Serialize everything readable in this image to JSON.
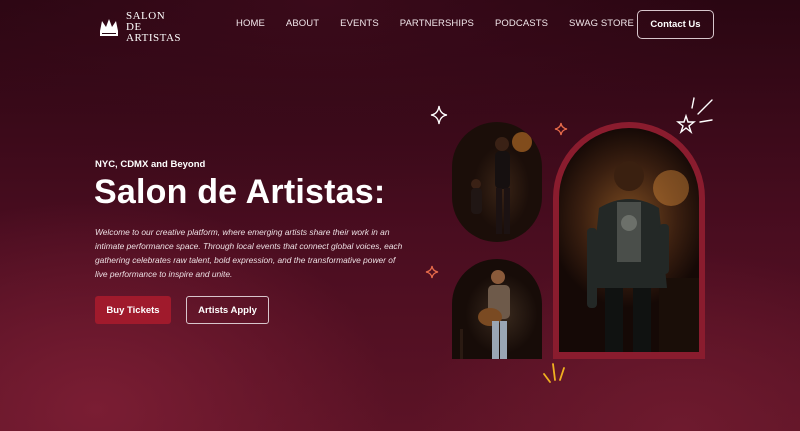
{
  "brand": {
    "name_line1": "SALON",
    "name_line2": "DE",
    "name_line3": "ARTISTAS",
    "logo_icon": "crown-logo-icon"
  },
  "nav": {
    "items": [
      "HOME",
      "ABOUT",
      "EVENTS",
      "PARTNERSHIPS",
      "PODCASTS",
      "SWAG STORE"
    ],
    "contact_label": "Contact Us"
  },
  "hero": {
    "tagline": "NYC, CDMX and Beyond",
    "title": "Salon de Artistas:",
    "description": "Welcome to our creative platform, where emerging artists share their work in an intimate performance space. Through local events that connect global voices, each gathering celebrates raw talent, bold expression, and the transformative power of live performance to inspire and unite.",
    "buy_label": "Buy Tickets",
    "apply_label": "Artists Apply"
  },
  "colors": {
    "accent": "#a01a2c",
    "frame": "#8a1c2e",
    "background": "#4a0d20"
  }
}
